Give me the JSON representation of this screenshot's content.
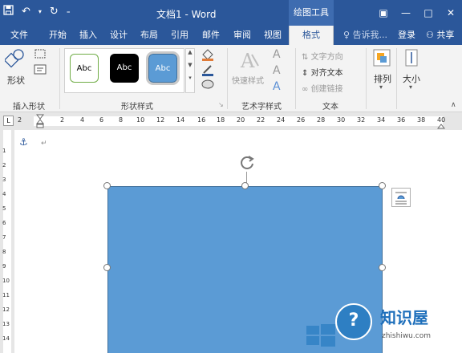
{
  "title_bar": {
    "doc_title": "文档1 - Word",
    "context_header": "绘图工具",
    "qat_icons": [
      "save-icon",
      "undo-icon",
      "redo-icon",
      "customize-icon"
    ],
    "win_icons": [
      "ribbon-display-icon",
      "minimize-icon",
      "maximize-icon",
      "close-icon"
    ]
  },
  "tabs": [
    {
      "label": "文件"
    },
    {
      "label": "开始"
    },
    {
      "label": "插入"
    },
    {
      "label": "设计"
    },
    {
      "label": "布局"
    },
    {
      "label": "引用"
    },
    {
      "label": "邮件"
    },
    {
      "label": "审阅"
    },
    {
      "label": "视图"
    },
    {
      "label": "格式",
      "active": true
    }
  ],
  "tell_me": "告诉我...",
  "login": "登录",
  "share": "共享",
  "ribbon": {
    "insert_shapes": {
      "shape_label": "形状",
      "group_label": "插入形状"
    },
    "shape_styles": {
      "samples": [
        "Abc",
        "Abc",
        "Abc"
      ],
      "group_label": "形状样式"
    },
    "wordart": {
      "quick_styles": "快速样式",
      "group_label": "艺术字样式"
    },
    "text": {
      "text_direction": "文字方向",
      "align_text": "对齐文本",
      "create_link": "创建链接",
      "group_label": "文本"
    },
    "arrange": {
      "label": "排列"
    },
    "size": {
      "label": "大小"
    }
  },
  "ruler": {
    "corner": "L",
    "h_numbers": [
      "2",
      "2",
      "4",
      "6",
      "8",
      "10",
      "12",
      "14",
      "16",
      "18",
      "20",
      "22",
      "24",
      "26",
      "28",
      "30",
      "32",
      "34",
      "36",
      "38",
      "40"
    ],
    "v_numbers": [
      "1",
      "2",
      "3",
      "4",
      "5",
      "6",
      "7",
      "8",
      "9",
      "10",
      "11",
      "12",
      "13",
      "14"
    ]
  },
  "watermark": {
    "title": "知识屋",
    "url": "zhishiwu.com",
    "badge": "?"
  },
  "colors": {
    "brand": "#2b579a",
    "shape_fill": "#5b9bd5",
    "shape_border": "#41719c"
  }
}
